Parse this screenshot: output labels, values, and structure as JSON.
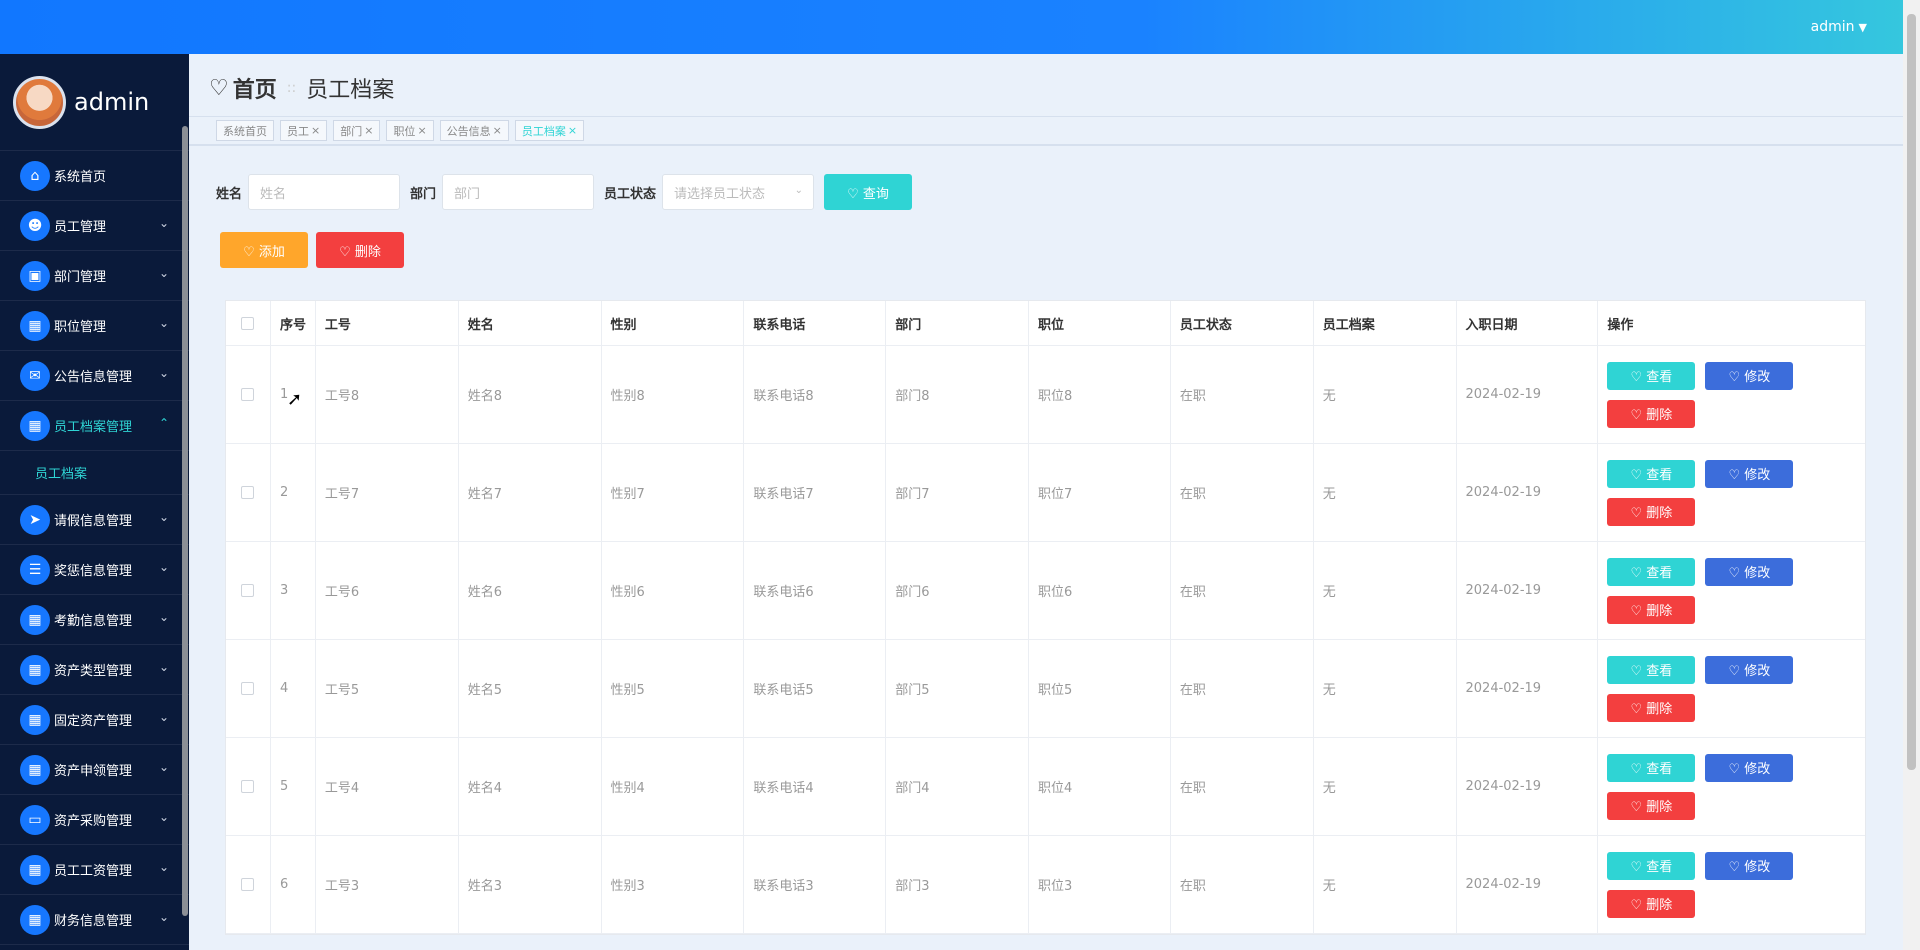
{
  "topbar": {
    "user": "admin",
    "caret": "▼"
  },
  "sidebar": {
    "username": "admin",
    "items": [
      {
        "label": "系统首页",
        "icon": "⌂",
        "chev": ""
      },
      {
        "label": "员工管理",
        "icon": "☻",
        "chev": "⌄"
      },
      {
        "label": "部门管理",
        "icon": "▣",
        "chev": "⌄"
      },
      {
        "label": "职位管理",
        "icon": "▦",
        "chev": "⌄"
      },
      {
        "label": "公告信息管理",
        "icon": "✉",
        "chev": "⌄"
      },
      {
        "label": "员工档案管理",
        "icon": "▦",
        "chev": "⌃"
      },
      {
        "label": "请假信息管理",
        "icon": "➤",
        "chev": "⌄"
      },
      {
        "label": "奖惩信息管理",
        "icon": "☰",
        "chev": "⌄"
      },
      {
        "label": "考勤信息管理",
        "icon": "▦",
        "chev": "⌄"
      },
      {
        "label": "资产类型管理",
        "icon": "▦",
        "chev": "⌄"
      },
      {
        "label": "固定资产管理",
        "icon": "▦",
        "chev": "⌄"
      },
      {
        "label": "资产申领管理",
        "icon": "▦",
        "chev": "⌄"
      },
      {
        "label": "资产采购管理",
        "icon": "▭",
        "chev": "⌄"
      },
      {
        "label": "员工工资管理",
        "icon": "▦",
        "chev": "⌄"
      },
      {
        "label": "财务信息管理",
        "icon": "▦",
        "chev": "⌄"
      }
    ],
    "sub_item": "员工档案"
  },
  "page": {
    "heart": "♡",
    "home": "首页",
    "sep": "::",
    "current": "员工档案"
  },
  "tabs": [
    "系统首页",
    "员工",
    "部门",
    "职位",
    "公告信息",
    "员工档案"
  ],
  "tab_close": "×",
  "search": {
    "name_label": "姓名",
    "name_placeholder": "姓名",
    "dept_label": "部门",
    "dept_placeholder": "部门",
    "status_label": "员工状态",
    "status_placeholder": "请选择员工状态",
    "dropdown_icon": "⌄",
    "query_label": "♡ 查询"
  },
  "actions": {
    "add_label": "♡ 添加",
    "delete_label": "♡ 删除"
  },
  "table": {
    "headers": [
      "序号",
      "工号",
      "姓名",
      "性别",
      "联系电话",
      "部门",
      "职位",
      "员工状态",
      "员工档案",
      "入职日期",
      "操作"
    ],
    "ops": {
      "view": "♡ 查看",
      "edit": "♡ 修改",
      "delete": "♡ 删除"
    },
    "rows": [
      [
        "1",
        "工号8",
        "姓名8",
        "性别8",
        "联系电话8",
        "部门8",
        "职位8",
        "在职",
        "无",
        "2024-02-19"
      ],
      [
        "2",
        "工号7",
        "姓名7",
        "性别7",
        "联系电话7",
        "部门7",
        "职位7",
        "在职",
        "无",
        "2024-02-19"
      ],
      [
        "3",
        "工号6",
        "姓名6",
        "性别6",
        "联系电话6",
        "部门6",
        "职位6",
        "在职",
        "无",
        "2024-02-19"
      ],
      [
        "4",
        "工号5",
        "姓名5",
        "性别5",
        "联系电话5",
        "部门5",
        "职位5",
        "在职",
        "无",
        "2024-02-19"
      ],
      [
        "5",
        "工号4",
        "姓名4",
        "性别4",
        "联系电话4",
        "部门4",
        "职位4",
        "在职",
        "无",
        "2024-02-19"
      ],
      [
        "6",
        "工号3",
        "姓名3",
        "性别3",
        "联系电话3",
        "部门3",
        "职位3",
        "在职",
        "无",
        "2024-02-19"
      ]
    ]
  },
  "cursor": "➚"
}
